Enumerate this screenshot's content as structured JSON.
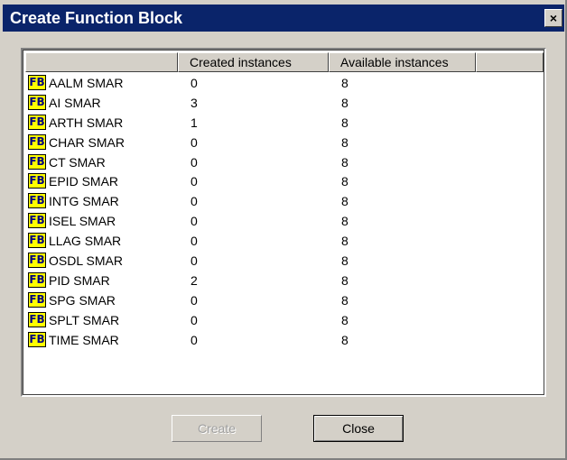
{
  "window": {
    "title": "Create Function Block",
    "close_glyph": "×"
  },
  "table": {
    "columns": [
      "",
      "Created instances",
      "Available instances",
      ""
    ],
    "icon_text": "FB",
    "rows": [
      {
        "name": "AALM SMAR",
        "created": "0",
        "available": "8"
      },
      {
        "name": "AI SMAR",
        "created": "3",
        "available": "8"
      },
      {
        "name": "ARTH SMAR",
        "created": "1",
        "available": "8"
      },
      {
        "name": "CHAR SMAR",
        "created": "0",
        "available": "8"
      },
      {
        "name": "CT SMAR",
        "created": "0",
        "available": "8"
      },
      {
        "name": "EPID SMAR",
        "created": "0",
        "available": "8"
      },
      {
        "name": "INTG SMAR",
        "created": "0",
        "available": "8"
      },
      {
        "name": "ISEL SMAR",
        "created": "0",
        "available": "8"
      },
      {
        "name": "LLAG SMAR",
        "created": "0",
        "available": "8"
      },
      {
        "name": "OSDL SMAR",
        "created": "0",
        "available": "8"
      },
      {
        "name": "PID SMAR",
        "created": "2",
        "available": "8"
      },
      {
        "name": "SPG SMAR",
        "created": "0",
        "available": "8"
      },
      {
        "name": "SPLT SMAR",
        "created": "0",
        "available": "8"
      },
      {
        "name": "TIME SMAR",
        "created": "0",
        "available": "8"
      }
    ]
  },
  "buttons": {
    "create_label": "Create",
    "close_label": "Close"
  },
  "colors": {
    "titlebar": "#0a246a",
    "icon_bg": "#ffff00",
    "dialog_bg": "#d4d0c8"
  }
}
